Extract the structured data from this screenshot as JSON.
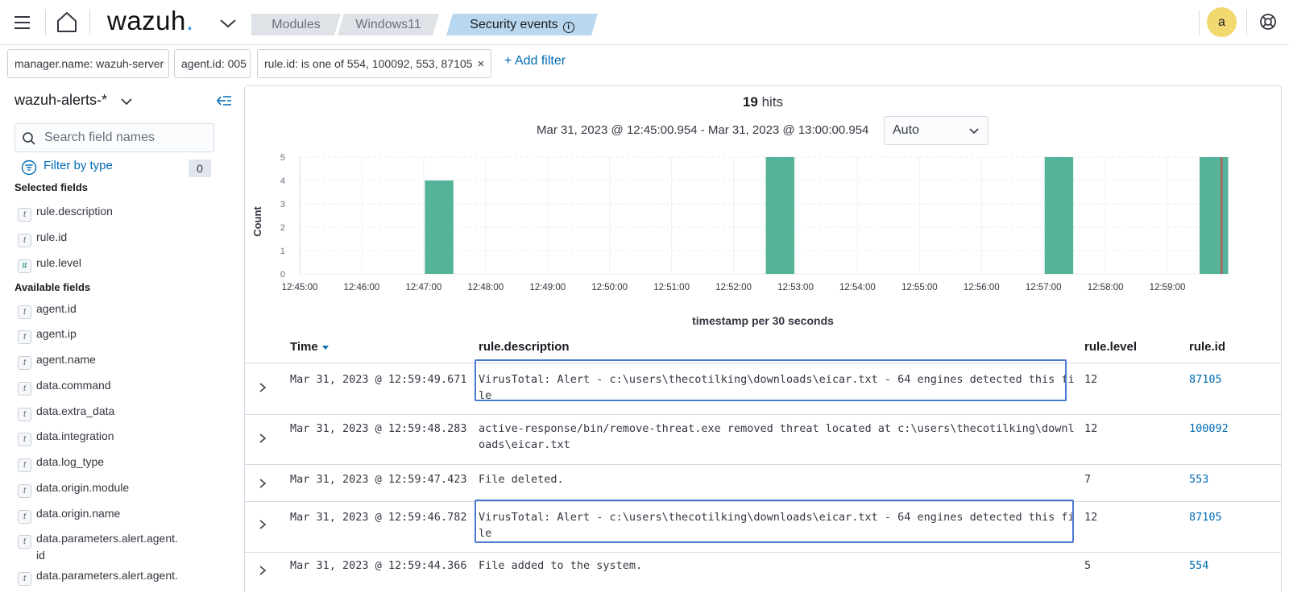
{
  "header": {
    "logo_text": "wazuh",
    "logo_dot": ".",
    "breadcrumbs": [
      "Modules",
      "Windows11",
      "Security events"
    ],
    "avatar_letter": "a"
  },
  "filters": {
    "pills": [
      "manager.name: wazuh-server",
      "agent.id: 005",
      "rule.id: is one of 554, 100092, 553, 87105"
    ],
    "remove_glyph": "×",
    "add_label": "+ Add filter"
  },
  "sidebar": {
    "index_pattern": "wazuh-alerts-*",
    "search_placeholder": "Search field names",
    "filter_by_type": "Filter by type",
    "filter_count": "0",
    "selected_title": "Selected fields",
    "selected_fields": [
      {
        "type": "t",
        "name": "rule.description"
      },
      {
        "type": "t",
        "name": "rule.id"
      },
      {
        "type": "#",
        "name": "rule.level"
      }
    ],
    "available_title": "Available fields",
    "available_fields": [
      {
        "type": "t",
        "name": "agent.id"
      },
      {
        "type": "t",
        "name": "agent.ip"
      },
      {
        "type": "t",
        "name": "agent.name"
      },
      {
        "type": "t",
        "name": "data.command"
      },
      {
        "type": "t",
        "name": "data.extra_data"
      },
      {
        "type": "t",
        "name": "data.integration"
      },
      {
        "type": "t",
        "name": "data.log_type"
      },
      {
        "type": "t",
        "name": "data.origin.module"
      },
      {
        "type": "t",
        "name": "data.origin.name"
      },
      {
        "type": "t",
        "name": "data.parameters.alert.agent.id",
        "line1": "data.parameters.alert.agent.",
        "line2": "id"
      },
      {
        "type": "t",
        "name": "data.parameters.alert.agent."
      }
    ]
  },
  "main": {
    "hits_count": "19",
    "hits_label": "hits",
    "time_range": "Mar 31, 2023 @ 12:45:00.954 - Mar 31, 2023 @ 13:00:00.954",
    "interval": "Auto"
  },
  "chart_data": {
    "type": "bar",
    "xlabel": "timestamp per 30 seconds",
    "ylabel": "Count",
    "ylim": [
      0,
      5
    ],
    "yticks": [
      0,
      1,
      2,
      3,
      4,
      5
    ],
    "x_tick_labels": [
      "12:45:00",
      "12:46:00",
      "12:47:00",
      "12:48:00",
      "12:49:00",
      "12:50:00",
      "12:51:00",
      "12:52:00",
      "12:53:00",
      "12:54:00",
      "12:55:00",
      "12:56:00",
      "12:57:00",
      "12:58:00",
      "12:59:00"
    ],
    "grid": true,
    "bars": [
      {
        "x": "12:47:00",
        "value": 4
      },
      {
        "x": "12:52:30",
        "value": 5
      },
      {
        "x": "12:57:00",
        "value": 5
      },
      {
        "x": "12:59:30",
        "value": 5
      }
    ],
    "bar_color": "#54b399",
    "now_marker_color": "#c0504d"
  },
  "table": {
    "columns": [
      "Time",
      "rule.description",
      "rule.level",
      "rule.id"
    ],
    "rows": [
      {
        "time": "Mar 31, 2023 @ 12:59:49.671",
        "description": "VirusTotal: Alert - c:\\users\\thecotilking\\downloads\\eicar.txt - 64 engines detected this file",
        "level": "12",
        "id": "87105"
      },
      {
        "time": "Mar 31, 2023 @ 12:59:48.283",
        "description": "active-response/bin/remove-threat.exe removed threat located at c:\\users\\thecotilking\\downloads\\eicar.txt",
        "level": "12",
        "id": "100092"
      },
      {
        "time": "Mar 31, 2023 @ 12:59:47.423",
        "description": "File deleted.",
        "level": "7",
        "id": "553"
      },
      {
        "time": "Mar 31, 2023 @ 12:59:46.782",
        "description": "VirusTotal: Alert - c:\\users\\thecotilking\\downloads\\eicar.txt - 64 engines detected this file",
        "level": "12",
        "id": "87105"
      },
      {
        "time": "Mar 31, 2023 @ 12:59:44.366",
        "description": "File added to the system.",
        "level": "5",
        "id": "554"
      }
    ]
  },
  "colors": {
    "accent": "#006bb4",
    "highlight_box": "#4a7bd0",
    "active_crumb": "#b9d7ee"
  }
}
